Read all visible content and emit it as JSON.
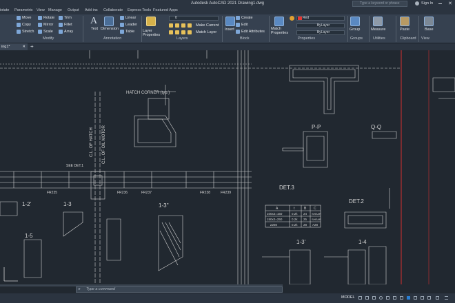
{
  "app": {
    "title": "Autodesk AutoCAD 2021   Drawing1.dwg",
    "search_placeholder": "Type a keyword or phrase",
    "sign_in": "Sign In"
  },
  "menu_tabs": [
    "iotate",
    "Parametric",
    "View",
    "Manage",
    "Output",
    "Add-ins",
    "Collaborate",
    "Express Tools",
    "Featured Apps"
  ],
  "ribbon": {
    "modify": {
      "label": "Modify",
      "items": [
        "Move",
        "Rotate",
        "Trim",
        "Copy",
        "Mirror",
        "Fillet",
        "Stretch",
        "Scale",
        "Array"
      ]
    },
    "annotation": {
      "label": "Annotation",
      "items": [
        "Text",
        "Dimension",
        "Linear",
        "Leader",
        "Table"
      ]
    },
    "layers": {
      "label": "Layers",
      "layer_properties": "Layer Properties",
      "current_layer": "0",
      "make_current": "Make Current",
      "match_layer": "Match Layer"
    },
    "block": {
      "label": "Block",
      "insert": "Insert",
      "create": "Create",
      "edit": "Edit",
      "edit_attributes": "Edit Attributes"
    },
    "properties": {
      "label": "Properties",
      "match_properties": "Match Properties",
      "color": "Red",
      "linetype": "ByLayer",
      "lineweight": "ByLayer",
      "color_hex": "#e53935"
    },
    "groups": {
      "label": "Groups",
      "group": "Group"
    },
    "utilities": {
      "label": "Utilities",
      "measure": "Measure"
    },
    "clipboard": {
      "label": "Clipboard",
      "paste": "Paste"
    },
    "view": {
      "label": "View",
      "base": "Base"
    }
  },
  "doc_tab": "ing1*",
  "drawing_text": {
    "hatch_corner": "HATCH CORNER (typ.)",
    "pp": "P-P",
    "qq": "Q-Q",
    "det3": "DET.3",
    "det2": "DET.2",
    "s12": "1-2'",
    "s13": "1-3",
    "s13b": "1-3''",
    "s15": "1-5",
    "s13c": "1-3'",
    "s14": "1-4",
    "cl_hatch": "C.L. OF HATCH",
    "cl_motor": "C.L. OF OIL MOTOR",
    "see_det": "SEE DET.1",
    "fr_labels": [
      "FR235",
      "FR236",
      "FR237",
      "FR238",
      "FR239"
    ],
    "table_rows": [
      [
        "A",
        "t",
        "B",
        "C"
      ],
      [
        "100x2=150",
        "0.2k",
        "24",
        "SHEAR"
      ],
      [
        "150x2=250",
        "0.2k",
        "25",
        "SHEAR"
      ],
      [
        "≥250",
        "0.2k",
        "28",
        "A28"
      ]
    ]
  },
  "command": {
    "placeholder": "Type a command"
  },
  "status": {
    "model": "MODEL"
  }
}
